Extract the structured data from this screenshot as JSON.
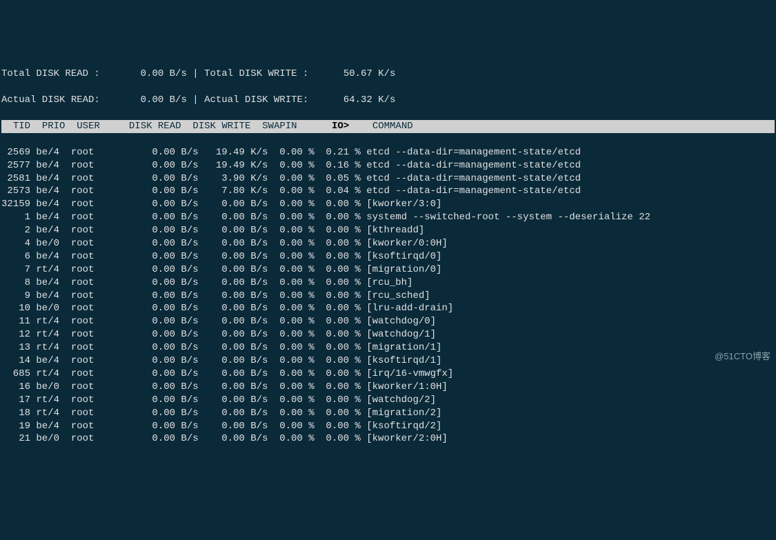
{
  "summary": {
    "total_read_label": "Total DISK READ :",
    "total_read_value": "0.00 B/s",
    "total_write_label": "Total DISK WRITE :",
    "total_write_value": "50.67 K/s",
    "actual_read_label": "Actual DISK READ:",
    "actual_read_value": "0.00 B/s",
    "actual_write_label": "Actual DISK WRITE:",
    "actual_write_value": "64.32 K/s"
  },
  "headers": {
    "tid": "TID",
    "prio": "PRIO",
    "user": "USER",
    "disk_read": "DISK READ",
    "disk_write": "DISK WRITE",
    "swapin": "SWAPIN",
    "io": "IO>",
    "command": "COMMAND"
  },
  "rows": [
    {
      "tid": "2569",
      "prio": "be/4",
      "user": "root",
      "dr": "0.00 B/s",
      "dw": "19.49 K/s",
      "sw": "0.00 %",
      "io": "0.21 %",
      "cmd": "etcd --data-dir=management-state/etcd"
    },
    {
      "tid": "2577",
      "prio": "be/4",
      "user": "root",
      "dr": "0.00 B/s",
      "dw": "19.49 K/s",
      "sw": "0.00 %",
      "io": "0.16 %",
      "cmd": "etcd --data-dir=management-state/etcd"
    },
    {
      "tid": "2581",
      "prio": "be/4",
      "user": "root",
      "dr": "0.00 B/s",
      "dw": "3.90 K/s",
      "sw": "0.00 %",
      "io": "0.05 %",
      "cmd": "etcd --data-dir=management-state/etcd"
    },
    {
      "tid": "2573",
      "prio": "be/4",
      "user": "root",
      "dr": "0.00 B/s",
      "dw": "7.80 K/s",
      "sw": "0.00 %",
      "io": "0.04 %",
      "cmd": "etcd --data-dir=management-state/etcd"
    },
    {
      "tid": "32159",
      "prio": "be/4",
      "user": "root",
      "dr": "0.00 B/s",
      "dw": "0.00 B/s",
      "sw": "0.00 %",
      "io": "0.00 %",
      "cmd": "[kworker/3:0]"
    },
    {
      "tid": "1",
      "prio": "be/4",
      "user": "root",
      "dr": "0.00 B/s",
      "dw": "0.00 B/s",
      "sw": "0.00 %",
      "io": "0.00 %",
      "cmd": "systemd --switched-root --system --deserialize 22"
    },
    {
      "tid": "2",
      "prio": "be/4",
      "user": "root",
      "dr": "0.00 B/s",
      "dw": "0.00 B/s",
      "sw": "0.00 %",
      "io": "0.00 %",
      "cmd": "[kthreadd]"
    },
    {
      "tid": "4",
      "prio": "be/0",
      "user": "root",
      "dr": "0.00 B/s",
      "dw": "0.00 B/s",
      "sw": "0.00 %",
      "io": "0.00 %",
      "cmd": "[kworker/0:0H]"
    },
    {
      "tid": "6",
      "prio": "be/4",
      "user": "root",
      "dr": "0.00 B/s",
      "dw": "0.00 B/s",
      "sw": "0.00 %",
      "io": "0.00 %",
      "cmd": "[ksoftirqd/0]"
    },
    {
      "tid": "7",
      "prio": "rt/4",
      "user": "root",
      "dr": "0.00 B/s",
      "dw": "0.00 B/s",
      "sw": "0.00 %",
      "io": "0.00 %",
      "cmd": "[migration/0]"
    },
    {
      "tid": "8",
      "prio": "be/4",
      "user": "root",
      "dr": "0.00 B/s",
      "dw": "0.00 B/s",
      "sw": "0.00 %",
      "io": "0.00 %",
      "cmd": "[rcu_bh]"
    },
    {
      "tid": "9",
      "prio": "be/4",
      "user": "root",
      "dr": "0.00 B/s",
      "dw": "0.00 B/s",
      "sw": "0.00 %",
      "io": "0.00 %",
      "cmd": "[rcu_sched]"
    },
    {
      "tid": "10",
      "prio": "be/0",
      "user": "root",
      "dr": "0.00 B/s",
      "dw": "0.00 B/s",
      "sw": "0.00 %",
      "io": "0.00 %",
      "cmd": "[lru-add-drain]"
    },
    {
      "tid": "11",
      "prio": "rt/4",
      "user": "root",
      "dr": "0.00 B/s",
      "dw": "0.00 B/s",
      "sw": "0.00 %",
      "io": "0.00 %",
      "cmd": "[watchdog/0]"
    },
    {
      "tid": "12",
      "prio": "rt/4",
      "user": "root",
      "dr": "0.00 B/s",
      "dw": "0.00 B/s",
      "sw": "0.00 %",
      "io": "0.00 %",
      "cmd": "[watchdog/1]"
    },
    {
      "tid": "13",
      "prio": "rt/4",
      "user": "root",
      "dr": "0.00 B/s",
      "dw": "0.00 B/s",
      "sw": "0.00 %",
      "io": "0.00 %",
      "cmd": "[migration/1]"
    },
    {
      "tid": "14",
      "prio": "be/4",
      "user": "root",
      "dr": "0.00 B/s",
      "dw": "0.00 B/s",
      "sw": "0.00 %",
      "io": "0.00 %",
      "cmd": "[ksoftirqd/1]"
    },
    {
      "tid": "685",
      "prio": "rt/4",
      "user": "root",
      "dr": "0.00 B/s",
      "dw": "0.00 B/s",
      "sw": "0.00 %",
      "io": "0.00 %",
      "cmd": "[irq/16-vmwgfx]"
    },
    {
      "tid": "16",
      "prio": "be/0",
      "user": "root",
      "dr": "0.00 B/s",
      "dw": "0.00 B/s",
      "sw": "0.00 %",
      "io": "0.00 %",
      "cmd": "[kworker/1:0H]"
    },
    {
      "tid": "17",
      "prio": "rt/4",
      "user": "root",
      "dr": "0.00 B/s",
      "dw": "0.00 B/s",
      "sw": "0.00 %",
      "io": "0.00 %",
      "cmd": "[watchdog/2]"
    },
    {
      "tid": "18",
      "prio": "rt/4",
      "user": "root",
      "dr": "0.00 B/s",
      "dw": "0.00 B/s",
      "sw": "0.00 %",
      "io": "0.00 %",
      "cmd": "[migration/2]"
    },
    {
      "tid": "19",
      "prio": "be/4",
      "user": "root",
      "dr": "0.00 B/s",
      "dw": "0.00 B/s",
      "sw": "0.00 %",
      "io": "0.00 %",
      "cmd": "[ksoftirqd/2]"
    },
    {
      "tid": "21",
      "prio": "be/0",
      "user": "root",
      "dr": "0.00 B/s",
      "dw": "0.00 B/s",
      "sw": "0.00 %",
      "io": "0.00 %",
      "cmd": "[kworker/2:0H]"
    }
  ],
  "watermark": "@51CTO博客"
}
